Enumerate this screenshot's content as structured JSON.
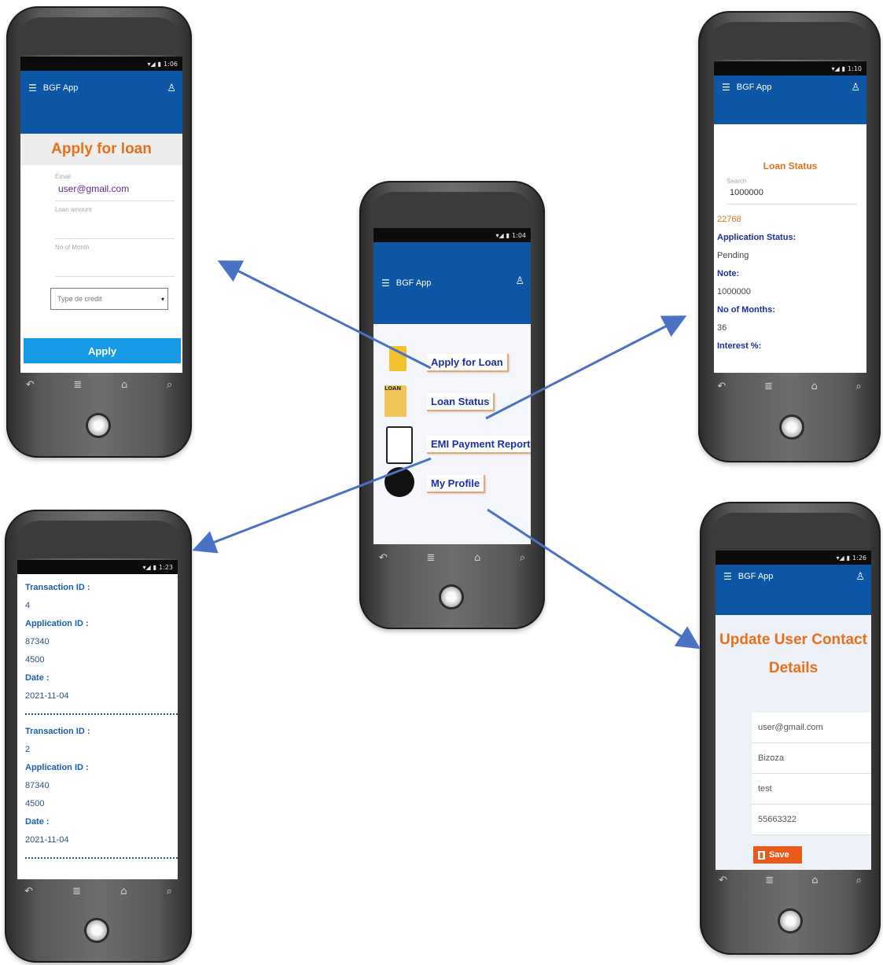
{
  "app": {
    "title": "BGF App",
    "menu_icon": "☰",
    "user_icon": "♙"
  },
  "phones": {
    "apply": {
      "time": "1:06",
      "header": "Apply for loan",
      "email_label": "Email",
      "email_value": "user@gmail.com",
      "amount_label": "Loan amount",
      "months_label": "No of Month",
      "credit_select": "Type de credit",
      "apply_button": "Apply"
    },
    "home": {
      "time": "1:04",
      "menu": [
        "Apply for Loan",
        "Loan Status",
        "EMI Payment Report",
        "My Profile"
      ]
    },
    "status": {
      "time": "1:10",
      "header": "Loan Status",
      "search_label": "Search",
      "search_value": "1000000",
      "id_value": "22768",
      "app_status_label": "Application Status:",
      "app_status_value": "Pending",
      "note_label": "Note:",
      "note_value": "1000000",
      "months_label": "No of Months:",
      "months_value": "36",
      "interest_label": "Interest %:"
    },
    "report": {
      "time": "1:23",
      "entries": [
        {
          "tx_label": "Transaction ID :",
          "tx_value": "4",
          "app_label": "Application ID :",
          "app_value": "87340",
          "amount": "4500",
          "date_label": "Date :",
          "date_value": "2021-11-04"
        },
        {
          "tx_label": "Transaction ID :",
          "tx_value": "2",
          "app_label": "Application ID :",
          "app_value": "87340",
          "amount": "4500",
          "date_label": "Date :",
          "date_value": "2021-11-04"
        }
      ]
    },
    "profile": {
      "time": "1:26",
      "header": "Update User Contact Details",
      "fields": [
        "user@gmail.com",
        "Bizoza",
        "test",
        "55663322"
      ],
      "save_button": "Save"
    }
  },
  "colors": {
    "appbar": "#0d56a6",
    "apply_button": "#1899e6",
    "orange_title": "#e8701a",
    "arrow": "#4a72c4",
    "save_button": "#e85a1c"
  },
  "nav_icons": [
    "back-icon",
    "menu-lines-icon",
    "home-icon",
    "search-icon"
  ]
}
